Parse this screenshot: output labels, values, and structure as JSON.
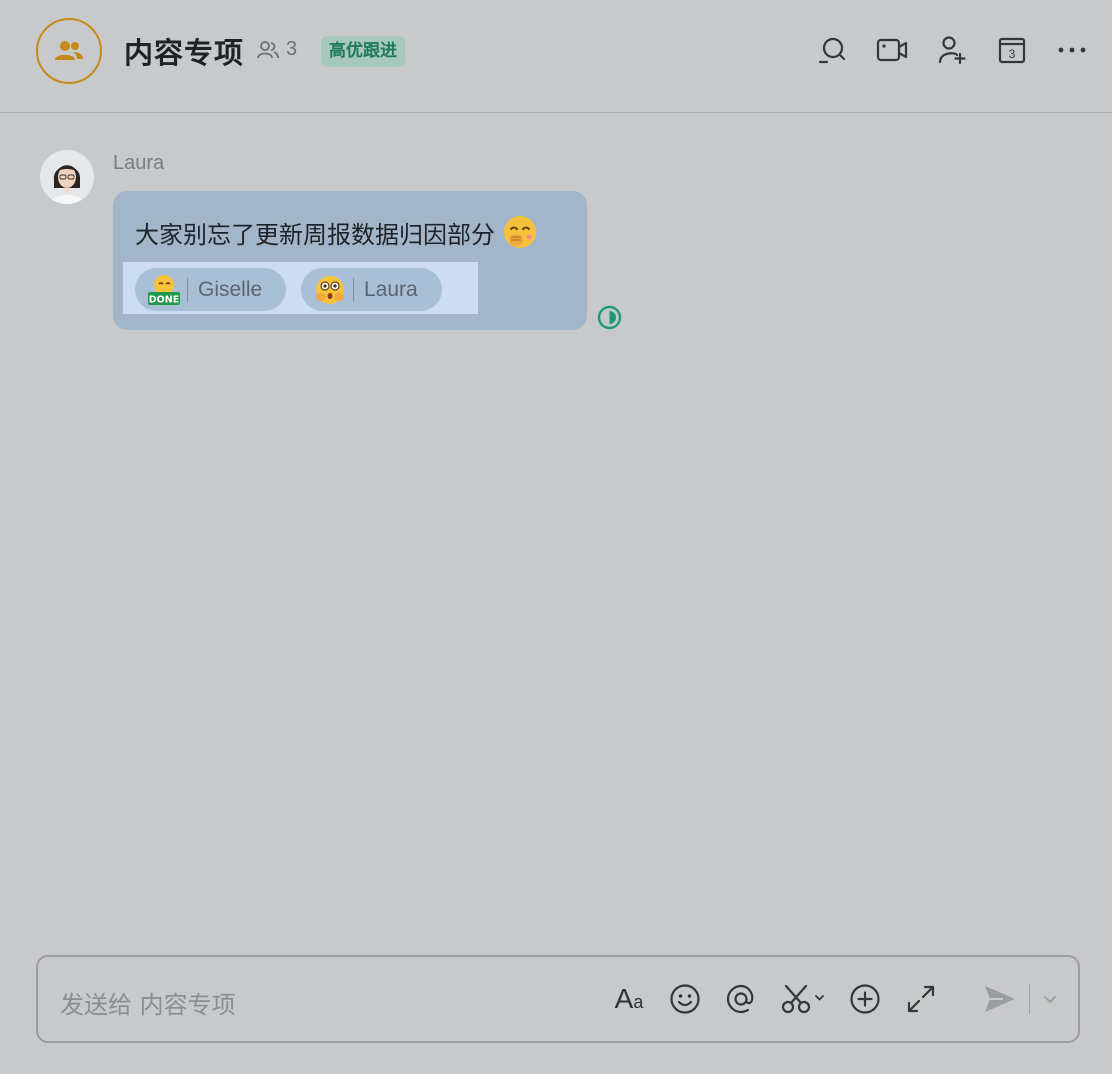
{
  "header": {
    "title": "内容专项",
    "member_count": "3",
    "tag": "高优跟进",
    "accent_color": "#c48a1c",
    "actions": [
      "search-icon",
      "video-icon",
      "add-member-icon",
      "calendar-icon",
      "more-icon"
    ],
    "calendar_day": "3"
  },
  "message": {
    "sender": "Laura",
    "text": "大家别忘了更新周报数据归因部分",
    "reactions": [
      {
        "user": "Giselle",
        "emoji": "done-emoji"
      },
      {
        "user": "Laura",
        "emoji": "shocked-emoji"
      }
    ]
  },
  "composer": {
    "placeholder": "发送给 内容专项",
    "font_tool": "A",
    "font_tool_small": "a"
  }
}
